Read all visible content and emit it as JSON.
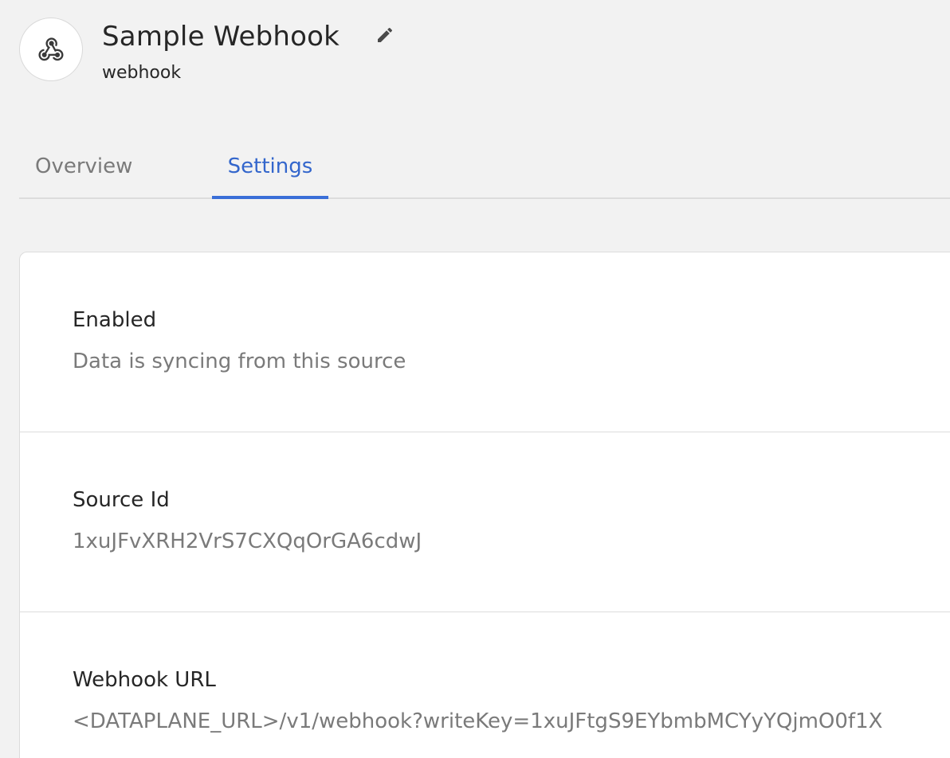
{
  "header": {
    "title": "Sample Webhook",
    "subtitle": "webhook",
    "source_icon": "webhook-icon",
    "edit_icon": "pencil-icon"
  },
  "tabs": [
    {
      "label": "Overview",
      "active": false
    },
    {
      "label": "Settings",
      "active": true
    }
  ],
  "settings": {
    "enabled": {
      "label": "Enabled",
      "description": "Data is syncing from this source"
    },
    "source_id": {
      "label": "Source Id",
      "value": "1xuJFvXRH2VrS7CXQqOrGA6cdwJ"
    },
    "webhook_url": {
      "label": "Webhook URL",
      "value": "<DATAPLANE_URL>/v1/webhook?writeKey=1xuJFtgS9EYbmbMCYyYQjmO0f1X"
    }
  },
  "colors": {
    "accent": "#3a6fd8",
    "background": "#f2f2f2",
    "card": "#ffffff"
  }
}
